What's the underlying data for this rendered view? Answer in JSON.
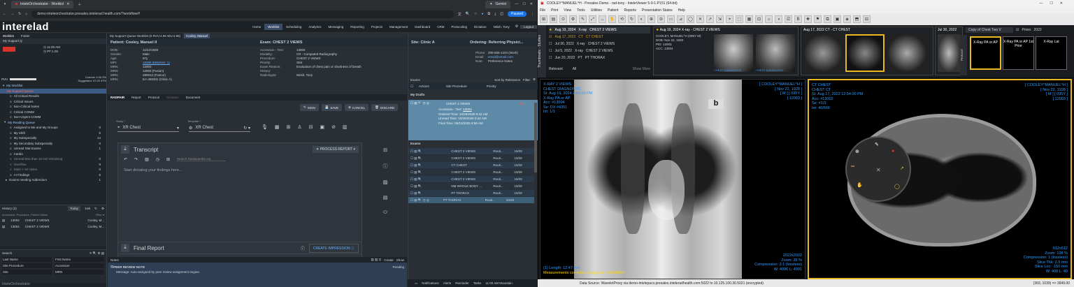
{
  "browser": {
    "tab1": "InteleOrchestrator - Worklist",
    "tab2": "Gemini",
    "url": "demo-inteleorchestrator.presales.intelerad health.com/?workflow#!",
    "paused": "Paused"
  },
  "app": {
    "logo": "interelad",
    "logo_text": "interelad",
    "nav": [
      "Home",
      "Worklist",
      "Scheduling",
      "Analytics",
      "Messaging",
      "Reporting",
      "Projects",
      "Management",
      "Dashboard",
      "CRM",
      "Protocoling",
      "Dictation"
    ],
    "user": "Nitish, Tony",
    "logout": "Logout",
    "logo_exact": "interelad"
  },
  "left": {
    "tabs": [
      "Worklist",
      "Folder"
    ],
    "support_q": "My Support Q",
    "time1": "11:00 AM",
    "time2": "PF:1.00",
    "rvu": "RVU",
    "current": "Current:",
    "current_val": "0.00 0%",
    "suggested": "Suggested:",
    "suggested_val": "47.00 47%",
    "items": [
      {
        "l": "My Worklist",
        "c": ""
      },
      {
        "l": "My Support Queue",
        "c": ""
      },
      {
        "l": "All Critical Results",
        "c": ""
      },
      {
        "l": "Critical Issues",
        "c": ""
      },
      {
        "l": "Non-Critical Notes",
        "c": ""
      },
      {
        "l": "Critical COMM",
        "c": ""
      },
      {
        "l": "Non-Urgent COMM",
        "c": ""
      },
      {
        "l": "My Reading Queue",
        "c": ""
      },
      {
        "l": "Assigned to Me and My Groups",
        "c": "0"
      },
      {
        "l": "My Shift",
        "c": "5"
      },
      {
        "l": "My Subspecialty",
        "c": "14"
      },
      {
        "l": "My Secondary Subspecialty",
        "c": "0"
      },
      {
        "l": "Unread Stat Exams",
        "c": "1"
      },
      {
        "l": "Cardio",
        "c": ""
      },
      {
        "l": "Unread less than 10 min remaining",
        "c": "0"
      },
      {
        "l": "Overflow",
        "c": "8"
      },
      {
        "l": "Stats > 10 cases",
        "c": "0"
      },
      {
        "l": "AI Findings",
        "c": "6"
      },
      {
        "l": "Exams needing Addendum",
        "c": "1"
      }
    ],
    "history": "History (2)",
    "today": "Today",
    "fltr": "1wk",
    "hcols": "Accession, Procedure, Patient Name",
    "hrows": [
      [
        "13004",
        "CHEST 2 VIEWS",
        "Cooley, M..."
      ],
      [
        "13004",
        "CHEST 2 VIEWS",
        "Cooley, M..."
      ]
    ],
    "search": "Search",
    "lname": "Last Name",
    "fname": "First Name",
    "proc": "Site Procedure",
    "acc": "Accession",
    "site": "Site",
    "mrn": "MRN",
    "footer": "InteleOrchestrator"
  },
  "mid": {
    "tabs": [
      "My Support Queue Worklist (0 RVU:4.96 WU:4.96)",
      "Cooley, Manuel"
    ],
    "patient": "Patient: Cooley, Manuel II",
    "exam": "Exam: CHEST 2 VIEWS",
    "pkv": [
      [
        "DOB:",
        "11/22/1928"
      ],
      [
        "Gender:",
        "Male"
      ],
      [
        "Age:",
        "97y"
      ],
      [
        "MPI:",
        "15485 (Matches: 1)"
      ],
      [
        "MRN:",
        "12003"
      ],
      [
        "MRN:",
        "12003 (Fusion)"
      ],
      [
        "MRN:",
        "280012 (Fusion)"
      ],
      [
        "MRN:",
        "EA-450331 (Clinic A)"
      ]
    ],
    "ekv": [
      [
        "Accession - Text:",
        "13004"
      ],
      [
        "Modality:",
        "CR - Computed Radiography"
      ],
      [
        "Procedure:",
        "CHEST 2 VIEWS"
      ],
      [
        "Priority:",
        "Stat"
      ],
      [
        "Exam Reason:",
        "Evaluation of chest pain or shortness of breath"
      ],
      [
        "History:",
        ""
      ],
      [
        "Radiologist:",
        "Nitish, Tony"
      ]
    ],
    "subtabs": [
      "RADPAIR",
      "Report",
      "Protocol",
      "Dictation",
      "Document"
    ],
    "actions": [
      "SIGN",
      "SAVE",
      "CANCEL",
      "DISCARD"
    ],
    "study": "XR Chest",
    "template": "XR Chest",
    "study_lbl": "Study *",
    "template_lbl": "Template *",
    "transcript": "Transcript",
    "process": "PROCESS REPORT",
    "search_rp": "Search Radiopaedia.org",
    "dictate": "Start dictating your findings here...",
    "final": "Final Report",
    "create": "CREATE IMPRESSION",
    "notes": "Notes",
    "create_btn": "Create",
    "show_btn": "Show",
    "note_title": "PEER REVIEW NOTE",
    "note_status": "Pending",
    "note_msg": "Message: Auto-assigned by peer review assignment engine."
  },
  "site": {
    "title": "Site: Clinic A",
    "ordering": "Ordering: Referring Physici...",
    "kv": [
      [
        "Phone:",
        "205-555-1234 (Work)"
      ],
      [
        "Email:",
        "email@email.com"
      ],
      [
        "Note:",
        "Preference Notes"
      ]
    ],
    "exams": "Exams",
    "sort": "Sort by Relevance",
    "filter": "Filter",
    "actions": "Actions",
    "site_proc": "Site Procedure",
    "priority": "Priority",
    "drafts": "My Drafts",
    "draft": {
      "proc": "CHEST 2 VIEWS",
      "status": "Stat",
      "acc": "Accession - Text:",
      "accv": "13004",
      "ord": "Ordered Time:",
      "ordv": "10/29/2025 9:42 AM",
      "unr": "Unread Time:",
      "unrv": "10/29/2025 9:42 AM",
      "fin": "Final Time:",
      "finv": "06/13/2025 8:56 AM"
    },
    "list": [
      {
        "p": "CHEST 2 VIEWS",
        "r": "Routi...",
        "d": "10/29"
      },
      {
        "p": "CHEST 2 VIEWS",
        "r": "Routi...",
        "d": "10/29"
      },
      {
        "p": "CT CHEST",
        "r": "Routi...",
        "d": "10/29"
      },
      {
        "p": "CHEST 2 VIEWS",
        "r": "Routi...",
        "d": "10/29"
      },
      {
        "p": "CHEST 2 VIEWS",
        "r": "Routi...",
        "d": "10/29"
      },
      {
        "p": "NM WHOLE BODY ...",
        "r": "Routi...",
        "d": "10/29"
      },
      {
        "p": "PT THORAX",
        "r": "Routi...",
        "d": "10/29"
      },
      {
        "p": "PT THORAX",
        "r": "Routi...",
        "d": "10/29"
      }
    ],
    "bottom": [
      "Notifications",
      "Alerts",
      "Reminder",
      "Tasks",
      "11:00 AM Mountain"
    ]
  },
  "iv": {
    "title": "COOLEY^MANUEL^H - Presales Demo - rad-tony - InteleViewer 5-9-1-P151 (64-bit)",
    "menu": [
      "File",
      "Print",
      "View",
      "Tools",
      "Utilities",
      "Patient",
      "Reports",
      "Presentation States",
      "Help"
    ],
    "studies": [
      {
        "d": "Aug 19, 2024",
        "m": "X-ray",
        "p": "CHEST 2 VIEWS"
      },
      {
        "d": "Aug 17, 2022",
        "m": "CT",
        "p": "CT CHEST"
      },
      {
        "d": "Jul 30, 2022",
        "m": "X-ray",
        "p": "CHEST 2 VIEWS"
      },
      {
        "d": "Jul 5, 2022",
        "m": "X-ray",
        "p": "CHEST 2 VIEWS"
      },
      {
        "d": "Jun 20, 2022",
        "m": "PT",
        "p": "PT THORAX"
      }
    ],
    "relevant": "Relevant",
    "all": "All",
    "more": "Show More",
    "cur_head": "Aug 19, 2024 X-ray - CHEST 2 VIEWS",
    "pinfo": [
      "COOLEY, MANUEL^H (095Y M)",
      "DOB: Nov 22, 1928",
      "PID: 12003",
      "ACC: 13004"
    ],
    "ct_head": "Aug 17, 2022 CT - CT CHEST",
    "jul_head": "Jul 30, 2022",
    "copy": "Copy of Chest Two V",
    "priors": "Priors",
    "prior_yr": "2022",
    "prot": [
      "X-Ray PA or AP",
      "X-Ray PA or AP 1st Prior",
      "X-Ray Lat"
    ],
    "thumb_lbl": "CHEST DIAGNOSTIC",
    "xr_tl": [
      "X-RAY 2 VIEWS",
      "CHEST DIAGNOSTIC",
      "St: Aug 19, 2024 2:42:00 PM",
      "X-Ray PA or AP",
      "Acc: #13004",
      "Se: DX #4351",
      "Im: 1/1"
    ],
    "xr_tr": [
      "[ COOLEY^MANUEL^H ]",
      "[ Nov 22, 1928 ]",
      "[ M ] [ 095Y ]",
      "[ 12003 ]"
    ],
    "xr_br": [
      "2022x2022",
      "Zoom: 35 %",
      "Compression: 2:1 (lossless)",
      "W: 4096 L: 4991"
    ],
    "xr_bl1": "(1) Length: 12.47 mm",
    "xr_bl2": "Measurements corrected using a derived ERMF.",
    "ct_tl": [
      "CT CHEST",
      "CHEST CT",
      "St: Aug 17, 2022 12:54:00 PM",
      "Acc: #13002",
      "Se: #1/3",
      "Im: 40/666"
    ],
    "ct_tr": [
      "[ COOLEY^MANUEL^H ]",
      "[ Nov 22, 1928 ]",
      "[ M ] [ 095Y ]",
      "[ 12003 ]"
    ],
    "ct_br": [
      "512x512",
      "Zoom: 138 %",
      "Compression: 1 (lossless)",
      "Slice Thk: 2.5 mm",
      "Slice Loc: -150 mm",
      "W: 400 L: 40"
    ],
    "status": "Data Source: WaveletProxy via demo-intelepacs.presales.inteleradhealth.com:5022 to 10.125.100.30.5021 (encrypted)",
    "coord": "(369, 1039) => 3849.00"
  }
}
